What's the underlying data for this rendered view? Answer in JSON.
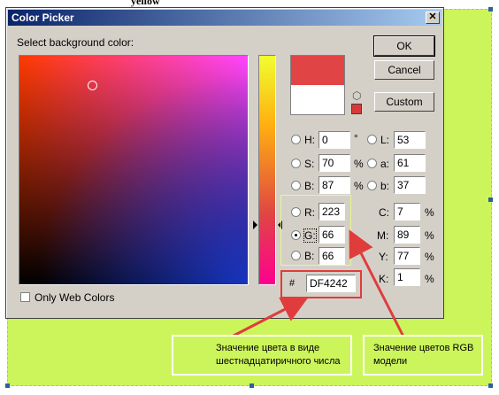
{
  "top_word": "yellow",
  "dialog": {
    "title": "Color Picker",
    "close_glyph": "✕",
    "prompt": "Select background color:",
    "buttons": {
      "ok": "OK",
      "cancel": "Cancel",
      "custom": "Custom"
    },
    "only_web_colors": "Only Web Colors",
    "hex_prefix": "#",
    "hex_value": "DF4242",
    "swatch": {
      "new_color": "#e04444",
      "current_color": "#ffffff",
      "mini_color": "#d83a3a"
    },
    "hsb": [
      {
        "label": "H:",
        "value": "0",
        "unit": "°"
      },
      {
        "label": "S:",
        "value": "70",
        "unit": "%"
      },
      {
        "label": "B:",
        "value": "87",
        "unit": "%"
      }
    ],
    "lab": [
      {
        "label": "L:",
        "value": "53"
      },
      {
        "label": "a:",
        "value": "61"
      },
      {
        "label": "b:",
        "value": "37"
      }
    ],
    "rgb": [
      {
        "label": "R:",
        "value": "223"
      },
      {
        "label": "G:",
        "value": "66"
      },
      {
        "label": "B:",
        "value": "66"
      }
    ],
    "cmyk": [
      {
        "label": "C:",
        "value": "7",
        "unit": "%"
      },
      {
        "label": "M:",
        "value": "89",
        "unit": "%"
      },
      {
        "label": "Y:",
        "value": "77",
        "unit": "%"
      },
      {
        "label": "K:",
        "value": "1",
        "unit": "%"
      }
    ],
    "selected_channel": "G"
  },
  "annotations": {
    "hex_note": "Значение цвета в виде шестнадцатиричного числа",
    "rgb_note": "Значение цветов RGB модели",
    "arrow_color": "#e03c3c"
  }
}
